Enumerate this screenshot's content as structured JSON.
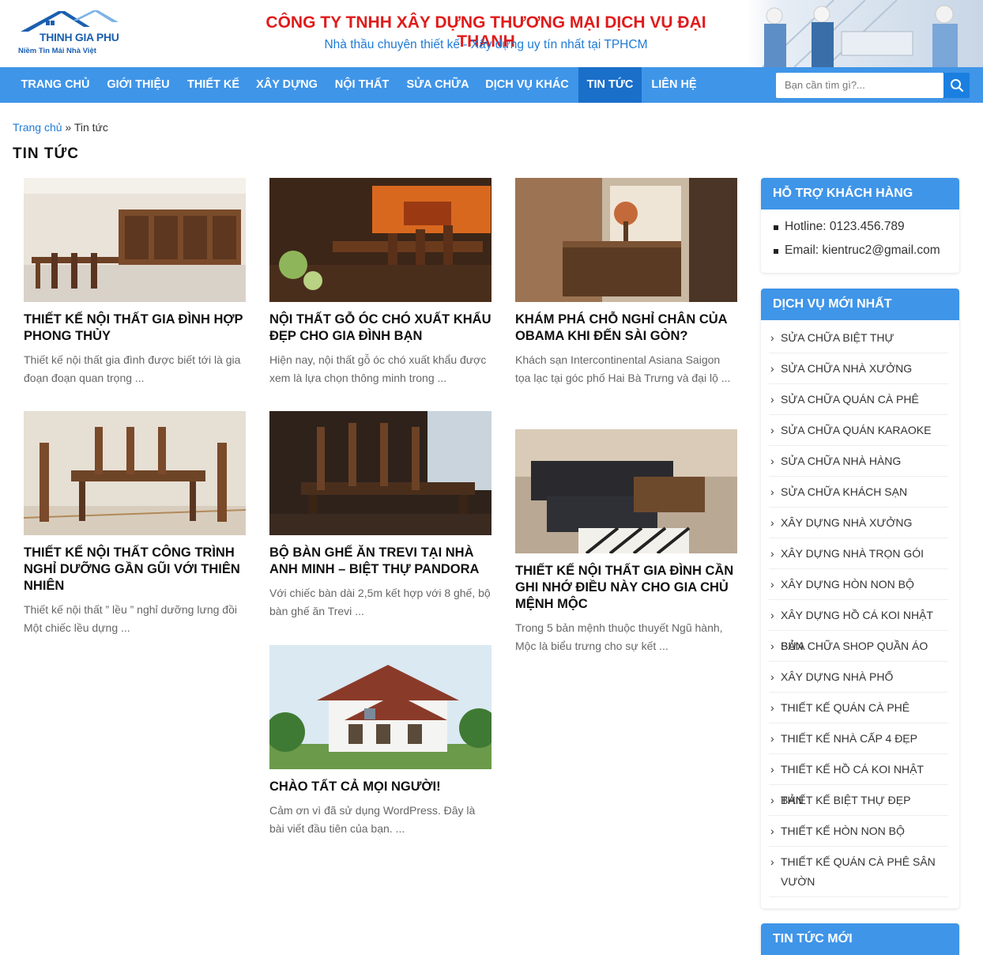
{
  "header": {
    "logo_brand": "THINH GIA PHU",
    "logo_slogan": "Niềm Tin Mái Nhà Việt",
    "company": "CÔNG TY TNHH XÂY DỰNG THƯƠNG MẠI DỊCH VỤ ĐẠI THANH",
    "tagline": "Nhà thầu chuyên thiết kế - Xây dựng uy tín nhất tại TPHCM"
  },
  "nav": {
    "items": [
      "TRANG CHỦ",
      "GIỚI THIỆU",
      "THIẾT KẾ",
      "XÂY DỰNG",
      "NỘI THẤT",
      "SỬA CHỮA",
      "DỊCH VỤ KHÁC",
      "TIN TỨC",
      "LIÊN HỆ"
    ],
    "active": "TIN TỨC",
    "search_placeholder": "Bạn cần tìm gì?..."
  },
  "breadcrumb": {
    "home": "Trang chủ",
    "separator": "»",
    "current": "Tin tức"
  },
  "page_title": "TIN TỨC",
  "posts": [
    {
      "title": "THIẾT KẾ NỘI THẤT GIA ĐÌNH HỢP PHONG THỦY",
      "excerpt": "Thiết kế nội thất gia đình được biết tới là gia đoạn đoạn quan trọng ..."
    },
    {
      "title": "NỘI THẤT GỖ ÓC CHÓ XUẤT KHẨU ĐẸP CHO GIA ĐÌNH BẠN",
      "excerpt": "Hiện nay, nội thất gỗ óc chó xuất khẩu được xem là lựa chọn thông minh trong ..."
    },
    {
      "title": "KHÁM PHÁ CHỖ NGHỈ CHÂN CỦA OBAMA KHI ĐẾN SÀI GÒN?",
      "excerpt": "Khách sạn Intercontinental Asiana Saigon tọa lạc tại góc phố Hai Bà Trưng và đại lộ ..."
    },
    {
      "title": "THIẾT KẾ NỘI THẤT CÔNG TRÌNH NGHỈ DƯỠNG GẦN GŨI VỚI THIÊN NHIÊN",
      "excerpt": "Thiết kế nội thất ” lều ” nghỉ dưỡng lưng đồi Một chiếc lều dựng ..."
    },
    {
      "title": "BỘ BÀN GHẾ ĂN TREVI TẠI NHÀ ANH MINH – BIỆT THỰ PANDORA",
      "excerpt": "Với chiếc bàn dài 2,5m kết hợp với 8 ghế, bộ bàn ghế ăn Trevi ..."
    },
    {
      "title": "THIẾT KẾ NỘI THẤT GIA ĐÌNH CẦN GHI NHỚ ĐIỀU NÀY CHO GIA CHỦ MỆNH MỘC",
      "excerpt": "Trong 5 bản mệnh thuộc thuyết Ngũ hành, Mộc là biểu trưng cho sự kết ..."
    },
    {
      "title": "CHÀO TẤT CẢ MỌI NGƯỜI!",
      "excerpt": "Cảm ơn vì đã sử dụng WordPress. Đây là bài viết đầu tiên của bạn. ..."
    }
  ],
  "sidebar": {
    "support": {
      "title": "HỖ TRỢ KHÁCH HÀNG",
      "items": [
        "Hotline: 0123.456.789",
        "Email: kientruc2@gmail.com"
      ]
    },
    "services": {
      "title": "DỊCH VỤ MỚI NHẤT",
      "items": [
        "SỬA CHỮA BIỆT THỰ",
        "SỬA CHỮA NHÀ XƯỞNG",
        "SỬA CHỮA QUÁN CÀ PHÊ",
        "SỬA CHỮA QUÁN KARAOKE",
        "SỬA CHỮA NHÀ HÀNG",
        "SỬA CHỮA KHÁCH SẠN",
        "XÂY DỰNG NHÀ XƯỞNG",
        "XÂY DỰNG NHÀ TRỌN GÓI",
        "XÂY DỰNG HÒN NON BỘ",
        "XÂY DỰNG HỒ CÁ KOI NHẬT BẢN",
        "SỬA CHỮA SHOP QUẦN ÁO",
        "XÂY DỰNG NHÀ PHỐ",
        "THIẾT KẾ QUÁN CÀ PHÊ",
        "THIẾT KẾ NHÀ CẤP 4 ĐẸP",
        "THIẾT KẾ HỒ CÁ KOI NHẬT BẢN",
        "THIẾT KẾ BIỆT THỰ ĐẸP",
        "THIẾT KẾ HÒN NON BỘ",
        "THIẾT KẾ QUÁN CÀ PHÊ SÂN VƯỜN"
      ]
    },
    "news": {
      "title": "TIN TỨC MỚI"
    }
  }
}
